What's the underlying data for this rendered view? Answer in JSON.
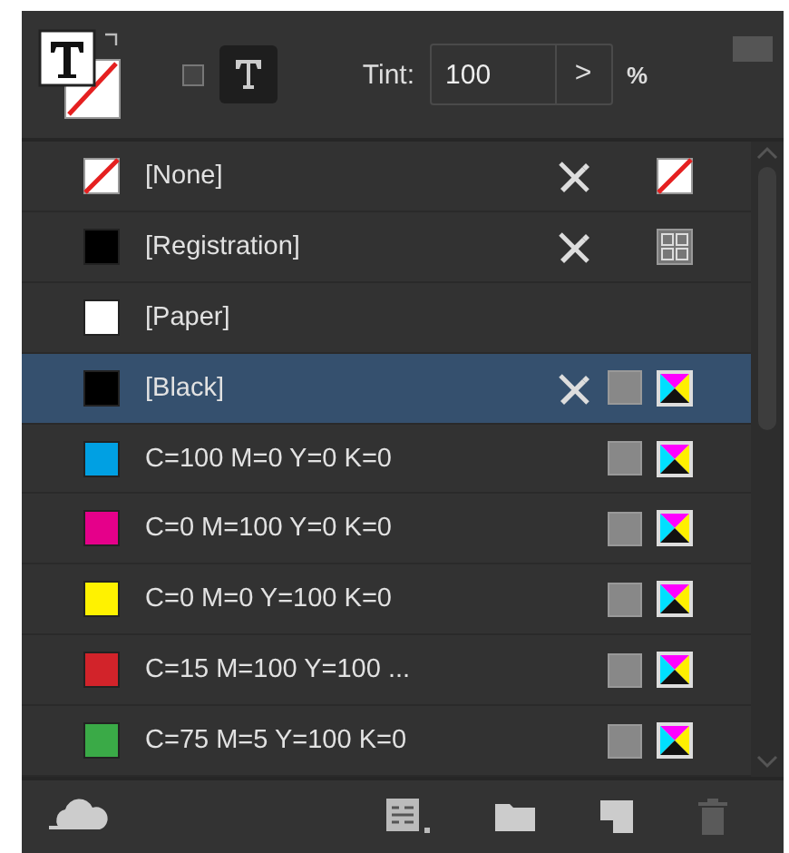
{
  "header": {
    "format_text": {
      "selected": true
    },
    "tint": {
      "label": "Tint:",
      "value": "100",
      "step": ">",
      "unit": "%"
    }
  },
  "swatches": [
    {
      "name": "[None]",
      "kind": "none",
      "locked": true,
      "process": false,
      "mode_icon": {
        "kind": "none"
      },
      "selected": false
    },
    {
      "name": "[Registration]",
      "kind": "color",
      "color": "#000000",
      "locked": true,
      "process": false,
      "mode_icon": {
        "kind": "registration"
      },
      "selected": false
    },
    {
      "name": "[Paper]",
      "kind": "color",
      "color": "#ffffff",
      "locked": false,
      "process": false,
      "selected": false
    },
    {
      "name": "[Black]",
      "kind": "color",
      "color": "#000000",
      "locked": true,
      "process": true,
      "mode_icon": {
        "kind": "cmyk"
      },
      "selected": true
    },
    {
      "name": "C=100 M=0 Y=0 K=0",
      "kind": "color",
      "color": "#00a0e3",
      "locked": false,
      "process": true,
      "mode_icon": {
        "kind": "cmyk"
      },
      "selected": false
    },
    {
      "name": "C=0 M=100 Y=0 K=0",
      "kind": "color",
      "color": "#e5008a",
      "locked": false,
      "process": true,
      "mode_icon": {
        "kind": "cmyk"
      },
      "selected": false
    },
    {
      "name": "C=0 M=0 Y=100 K=0",
      "kind": "color",
      "color": "#fff200",
      "locked": false,
      "process": true,
      "mode_icon": {
        "kind": "cmyk"
      },
      "selected": false
    },
    {
      "name": "C=15 M=100 Y=100 ...",
      "kind": "color",
      "color": "#d2232a",
      "locked": false,
      "process": true,
      "mode_icon": {
        "kind": "cmyk"
      },
      "selected": false
    },
    {
      "name": "C=75 M=5 Y=100 K=0",
      "kind": "color",
      "color": "#3aaa47",
      "locked": false,
      "process": true,
      "mode_icon": {
        "kind": "cmyk"
      },
      "selected": false
    }
  ]
}
